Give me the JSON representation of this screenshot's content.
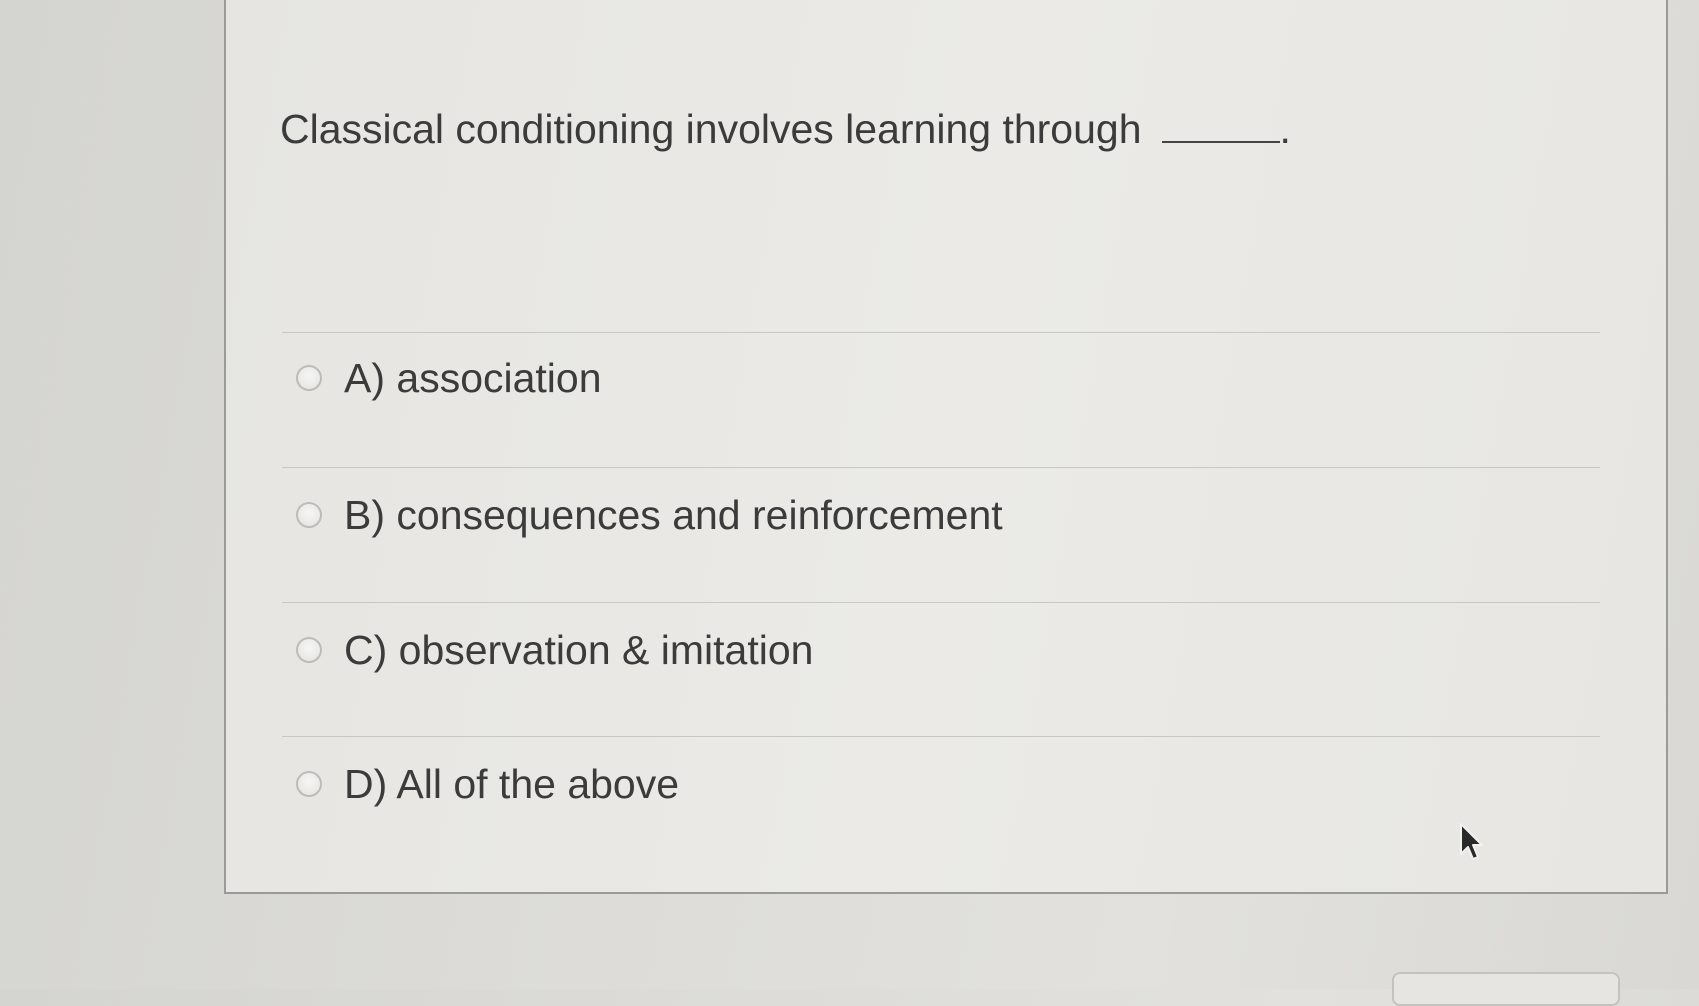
{
  "question": {
    "text": "Classical conditioning involves learning through",
    "end_punct": "."
  },
  "options": [
    {
      "label": "A) association",
      "selected": false
    },
    {
      "label": "B) consequences and reinforcement",
      "selected": false
    },
    {
      "label": "C) observation & imitation",
      "selected": false
    },
    {
      "label": "D) All of the above",
      "selected": false
    }
  ],
  "icons": {
    "cursor": "mouse-pointer-icon",
    "radio": "radio-unchecked"
  },
  "colors": {
    "text": "#3b3b3b",
    "border": "#9a9a98",
    "divider": "#c9c8c4",
    "background": "#e6e5e1"
  }
}
